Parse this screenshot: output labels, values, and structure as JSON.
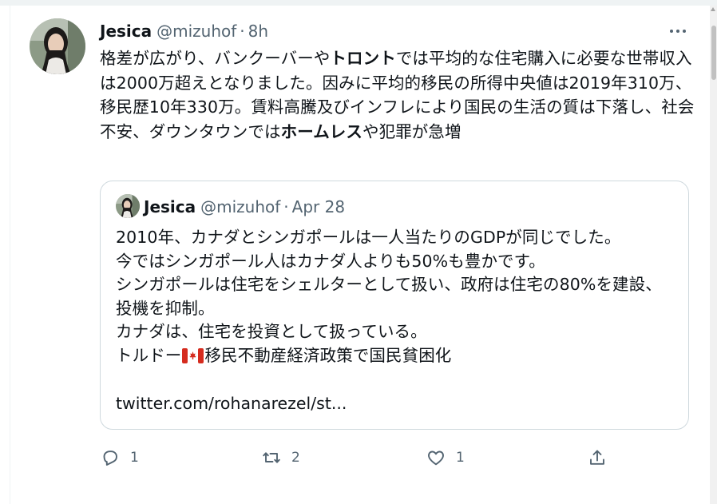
{
  "tweet": {
    "author_name": "Jesica",
    "handle": "@mizuhof",
    "separator": "·",
    "time": "8h",
    "text_parts": [
      "格差が広がり、バンクーバーや",
      "トロント",
      "では平均的な住宅購入に必要な世帯収入は2000万超えとなりました。因みに平均的移民の所得中央値は2019年310万、移民歴10年330万。賃料高騰及びインフレにより国民の生活の質は下落し、社会不安、ダウンタウンでは",
      "ホームレス",
      "や犯罪が急増"
    ]
  },
  "quote": {
    "author_name": "Jesica",
    "handle": "@mizuhof",
    "separator": "·",
    "time": "Apr 28",
    "body": "2010年、カナダとシンガポールは一人当たりのGDPが同じでした。\n今ではシンガポール人はカナダ人よりも50%も豊かです。\nシンガポールは住宅をシェルターとして扱い、政府は住宅の80%を建設、投機を抑制。\nカナダは、住宅を投資として扱っている。\n",
    "last_line_before_flag": "トルドー",
    "last_line_after_flag": "移民不動産経済政策で国民貧困化",
    "link": "twitter.com/rohanarezel/st..."
  },
  "actions": {
    "reply": {
      "icon": "reply-icon",
      "count": "1"
    },
    "retweet": {
      "icon": "retweet-icon",
      "count": "2"
    },
    "like": {
      "icon": "heart-icon",
      "count": "1"
    },
    "share": {
      "icon": "share-icon",
      "count": ""
    }
  },
  "colors": {
    "text": "#0f1419",
    "secondary": "#536471",
    "border": "#cfd9de",
    "canada_red": "#d52b1e"
  }
}
